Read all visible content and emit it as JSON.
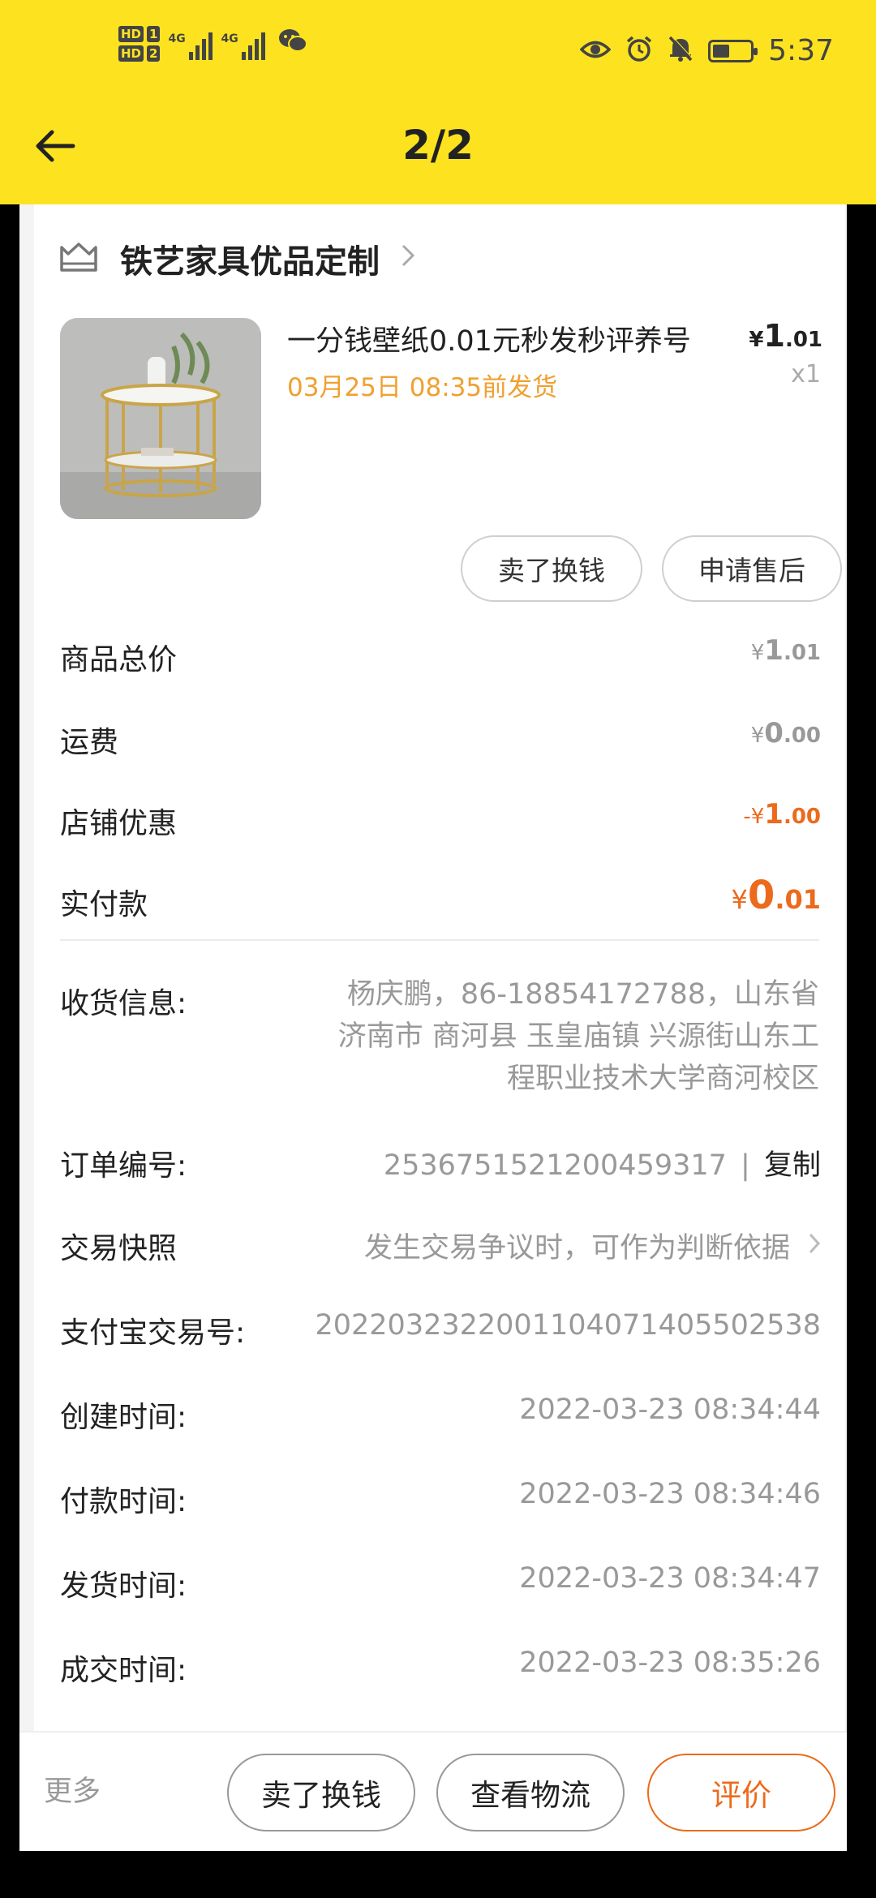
{
  "status_bar": {
    "hd1": "HD",
    "hd1_num": "1",
    "hd2": "HD",
    "hd2_num": "2",
    "net1": "4G",
    "net2": "4G",
    "time": "5:37",
    "icons": [
      "eye-icon",
      "alarm-icon",
      "mute-bell-icon",
      "battery-icon"
    ]
  },
  "viewer": {
    "page_counter": "2/2"
  },
  "shop": {
    "name": "铁艺家具优品定制"
  },
  "product": {
    "title": "一分钱壁纸0.01元秒发秒评养号",
    "ship_note": "03月25日 08:35前发货",
    "price_currency": "¥",
    "price_int": "1",
    "price_dec": ".01",
    "qty": "x1"
  },
  "product_actions": {
    "sell": "卖了换钱",
    "after_sale": "申请售后"
  },
  "summary": {
    "items_total_label": "商品总价",
    "items_total": {
      "cur": "¥",
      "int": "1",
      "dec": ".01"
    },
    "shipping_label": "运费",
    "shipping": {
      "cur": "¥",
      "int": "0",
      "dec": ".00"
    },
    "store_discount_label": "店铺优惠",
    "store_discount": {
      "cur": "-¥",
      "int": "1",
      "dec": ".00"
    },
    "paid_label": "实付款",
    "paid": {
      "cur": "¥",
      "int": "0",
      "dec": ".01"
    }
  },
  "details": {
    "address_label": "收货信息:",
    "address_line1": "杨庆鹏，86-18854172788，山东省",
    "address_line2": "济南市 商河县 玉皇庙镇 兴源街山东工",
    "address_line3": "程职业技术大学商河校区",
    "order_no_label": "订单编号:",
    "order_no": "2536751521200459317",
    "order_sep": "|",
    "copy": "复制",
    "snapshot_label": "交易快照",
    "snapshot_value": "发生交易争议时，可作为判断依据",
    "alipay_label": "支付宝交易号:",
    "alipay_no": "2022032322001104071405502538",
    "created_label": "创建时间:",
    "created": "2022-03-23 08:34:44",
    "paid_time_label": "付款时间:",
    "paid_time": "2022-03-23 08:34:46",
    "shipped_label": "发货时间:",
    "shipped": "2022-03-23 08:34:47",
    "closed_label": "成交时间:",
    "closed": "2022-03-23 08:35:26"
  },
  "bottom_bar": {
    "more": "更多",
    "sell": "卖了换钱",
    "logistics": "查看物流",
    "review": "评价"
  },
  "colors": {
    "header_yellow": "#fde31f",
    "accent_orange": "#ec6a1c",
    "ship_note_orange": "#f0a030"
  },
  "battery_level": 0.45
}
